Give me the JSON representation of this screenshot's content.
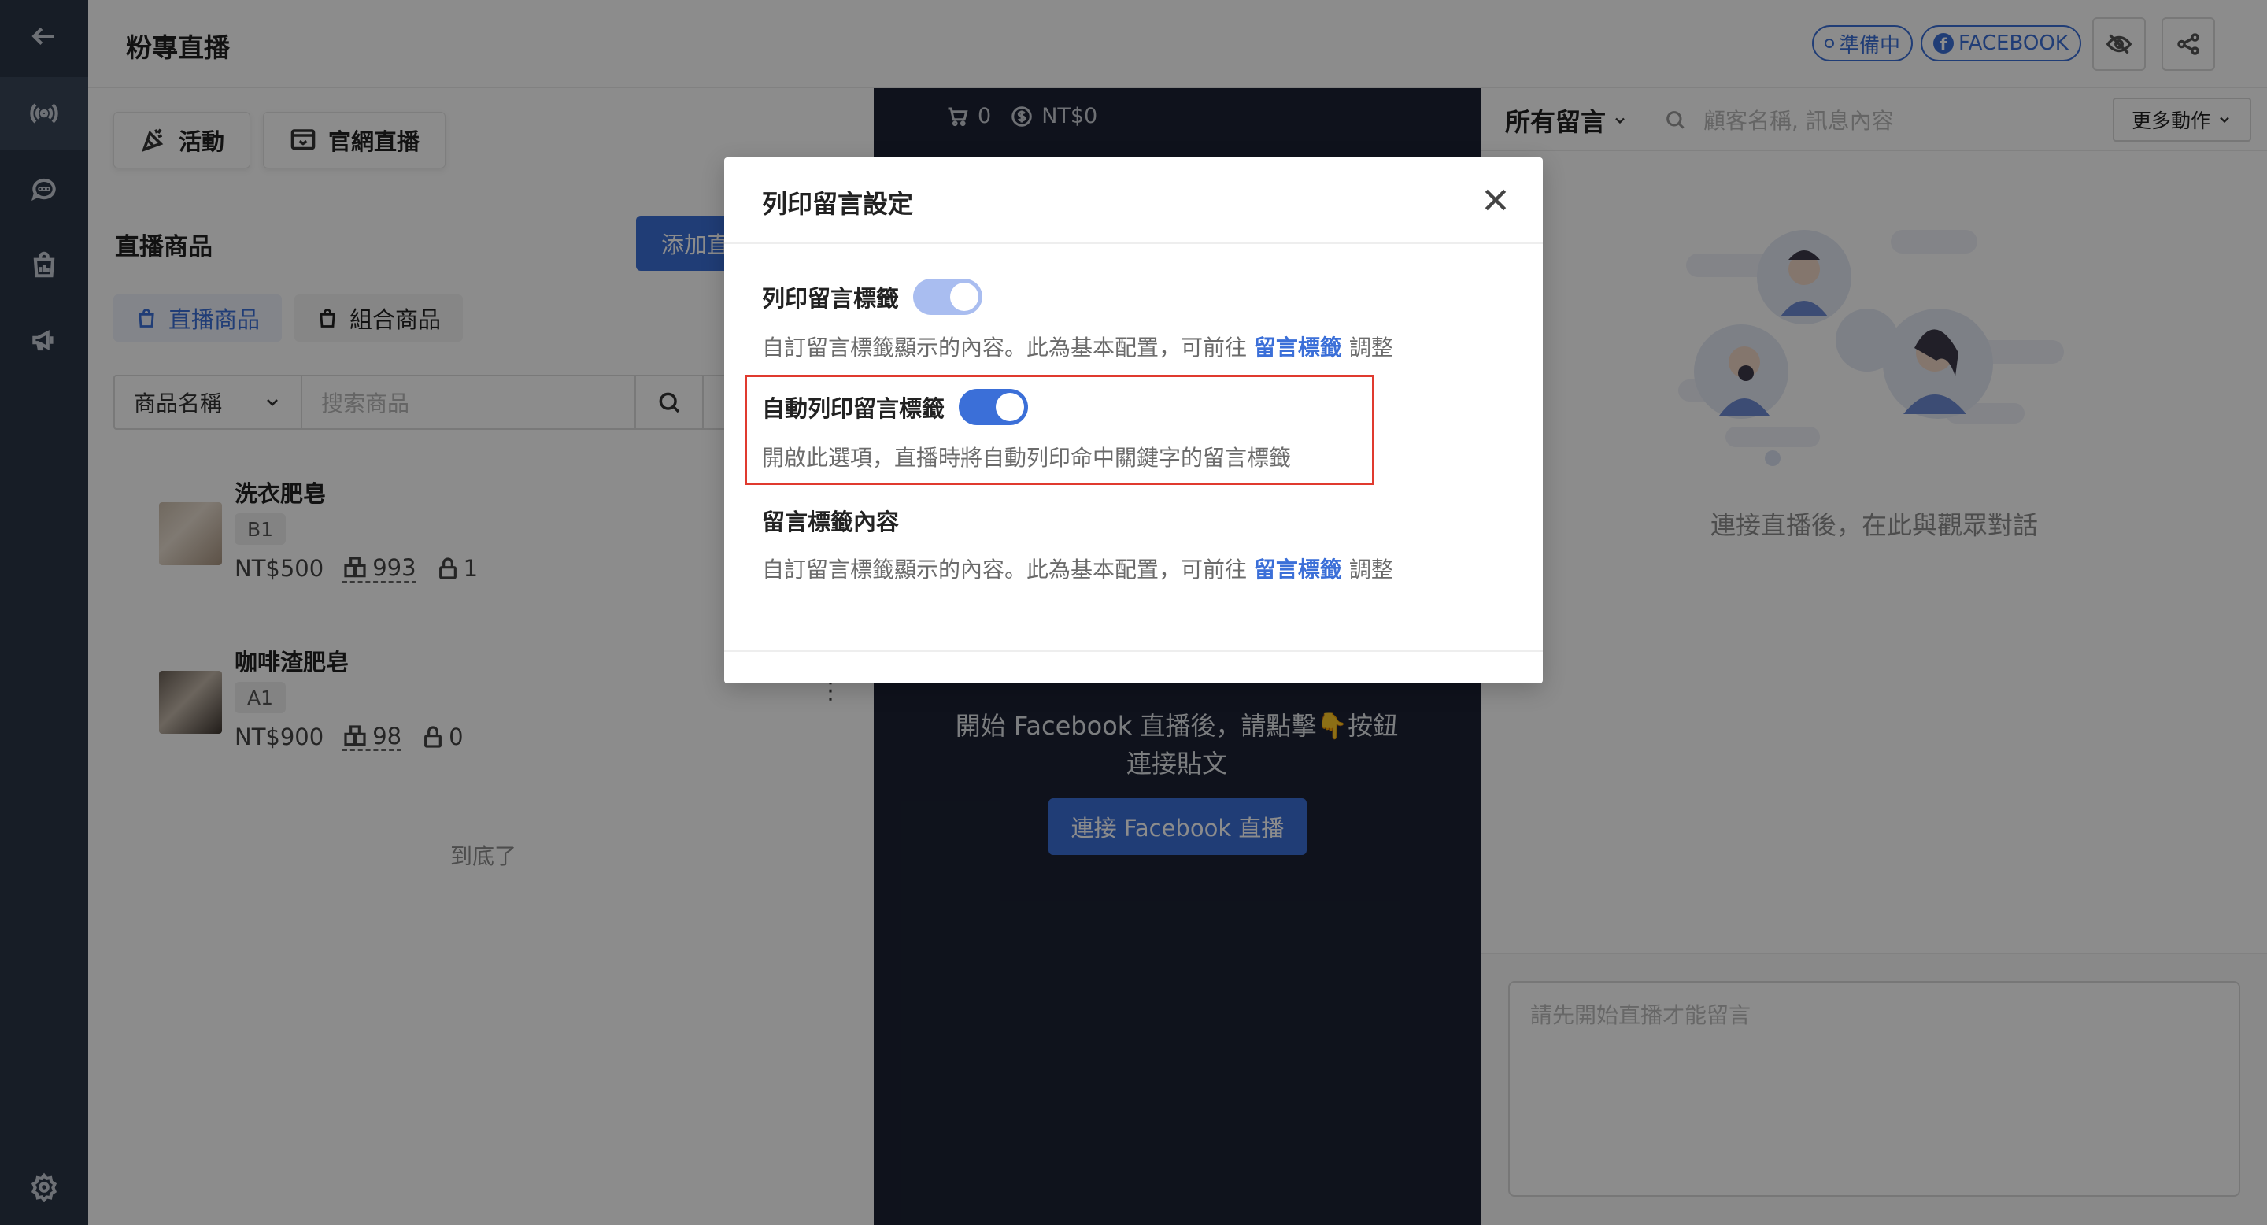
{
  "header": {
    "title": "粉專直播",
    "status_pill": "準備中",
    "platform_pill": "FACEBOOK"
  },
  "left": {
    "activity_btn": "活動",
    "website_live_btn": "官網直播",
    "section_title": "直播商品",
    "add_btn": "添加直播商品",
    "tabs": [
      {
        "label": "直播商品"
      },
      {
        "label": "組合商品"
      }
    ],
    "filter": {
      "select_value": "商品名稱",
      "search_placeholder": "搜索商品"
    },
    "products": [
      {
        "name": "洗衣肥皂",
        "code": "B1",
        "price": "NT$500",
        "stock": "993",
        "locked": "1"
      },
      {
        "name": "咖啡渣肥皂",
        "code": "A1",
        "price": "NT$900",
        "stock": "98",
        "locked": "0"
      }
    ],
    "end_text": "到底了"
  },
  "mid": {
    "cart_count": "0",
    "cart_amount": "NT$0",
    "hint_line1": "開始 Facebook 直播後，請點擊👇按鈕",
    "hint_line2": "連接貼文",
    "connect_btn": "連接 Facebook 直播"
  },
  "right": {
    "all_comments": "所有留言",
    "search_placeholder": "顧客名稱, 訊息內容",
    "more_actions": "更多動作",
    "empty_text": "連接直播後，在此與觀眾對話",
    "compose_placeholder": "請先開始直播才能留言"
  },
  "modal": {
    "title": "列印留言設定",
    "settings": [
      {
        "label": "列印留言標籤",
        "desc_prefix": "自訂留言標籤顯示的內容。此為基本配置，可前往 ",
        "desc_link": "留言標籤",
        "desc_suffix": " 調整",
        "toggle": "faded"
      },
      {
        "label": "自動列印留言標籤",
        "desc": "開啟此選項，直播時將自動列印命中關鍵字的留言標籤",
        "toggle": "on"
      },
      {
        "label": "留言標籤內容",
        "desc_prefix": "自訂留言標籤顯示的內容。此為基本配置，可前往 ",
        "desc_link": "留言標籤",
        "desc_suffix": " 調整"
      }
    ]
  },
  "colors": {
    "accent": "#3b6fd8",
    "nav_bg": "#2b3546",
    "video_bg": "#1c2233",
    "highlight": "#e03a2f"
  }
}
